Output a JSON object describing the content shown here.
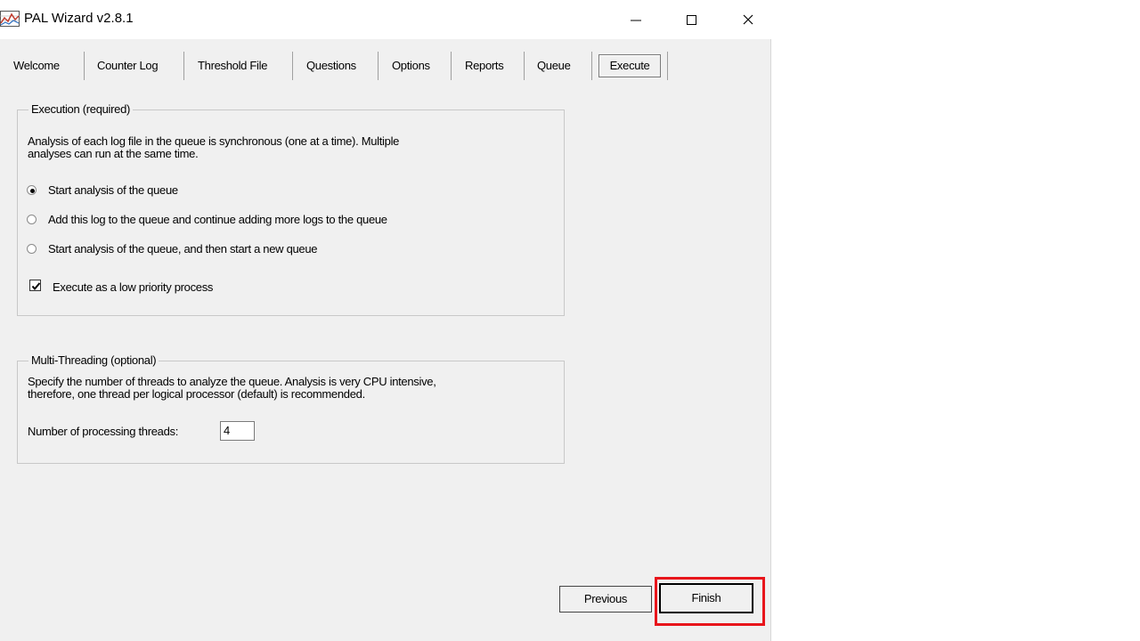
{
  "window": {
    "title": "PAL Wizard v2.8.1"
  },
  "tabs": [
    {
      "label": "Welcome"
    },
    {
      "label": "Counter Log"
    },
    {
      "label": "Threshold File"
    },
    {
      "label": "Questions"
    },
    {
      "label": "Options"
    },
    {
      "label": "Reports"
    },
    {
      "label": "Queue"
    },
    {
      "label": "Execute",
      "active": true
    }
  ],
  "execution": {
    "title": "Execution (required)",
    "description": "Analysis of each log file in the queue is synchronous (one at a time). Multiple\nanalyses can run at the same time.",
    "options": [
      {
        "label": "Start analysis of the queue",
        "selected": true
      },
      {
        "label": "Add this log to the queue and continue adding more logs to the queue",
        "selected": false
      },
      {
        "label": "Start analysis of the queue, and then start a new queue",
        "selected": false
      }
    ],
    "low_priority": {
      "label": "Execute as a low priority process",
      "checked": true
    }
  },
  "multithreading": {
    "title": "Multi-Threading (optional)",
    "description": "Specify the number of threads to analyze the queue. Analysis is very CPU intensive,\ntherefore, one thread per logical processor (default) is recommended.",
    "threads_label": "Number of processing threads:",
    "threads_value": "4"
  },
  "buttons": {
    "previous": "Previous",
    "finish": "Finish"
  },
  "colors": {
    "highlight": "#e8151b",
    "window_bg": "#f0f0f0"
  }
}
